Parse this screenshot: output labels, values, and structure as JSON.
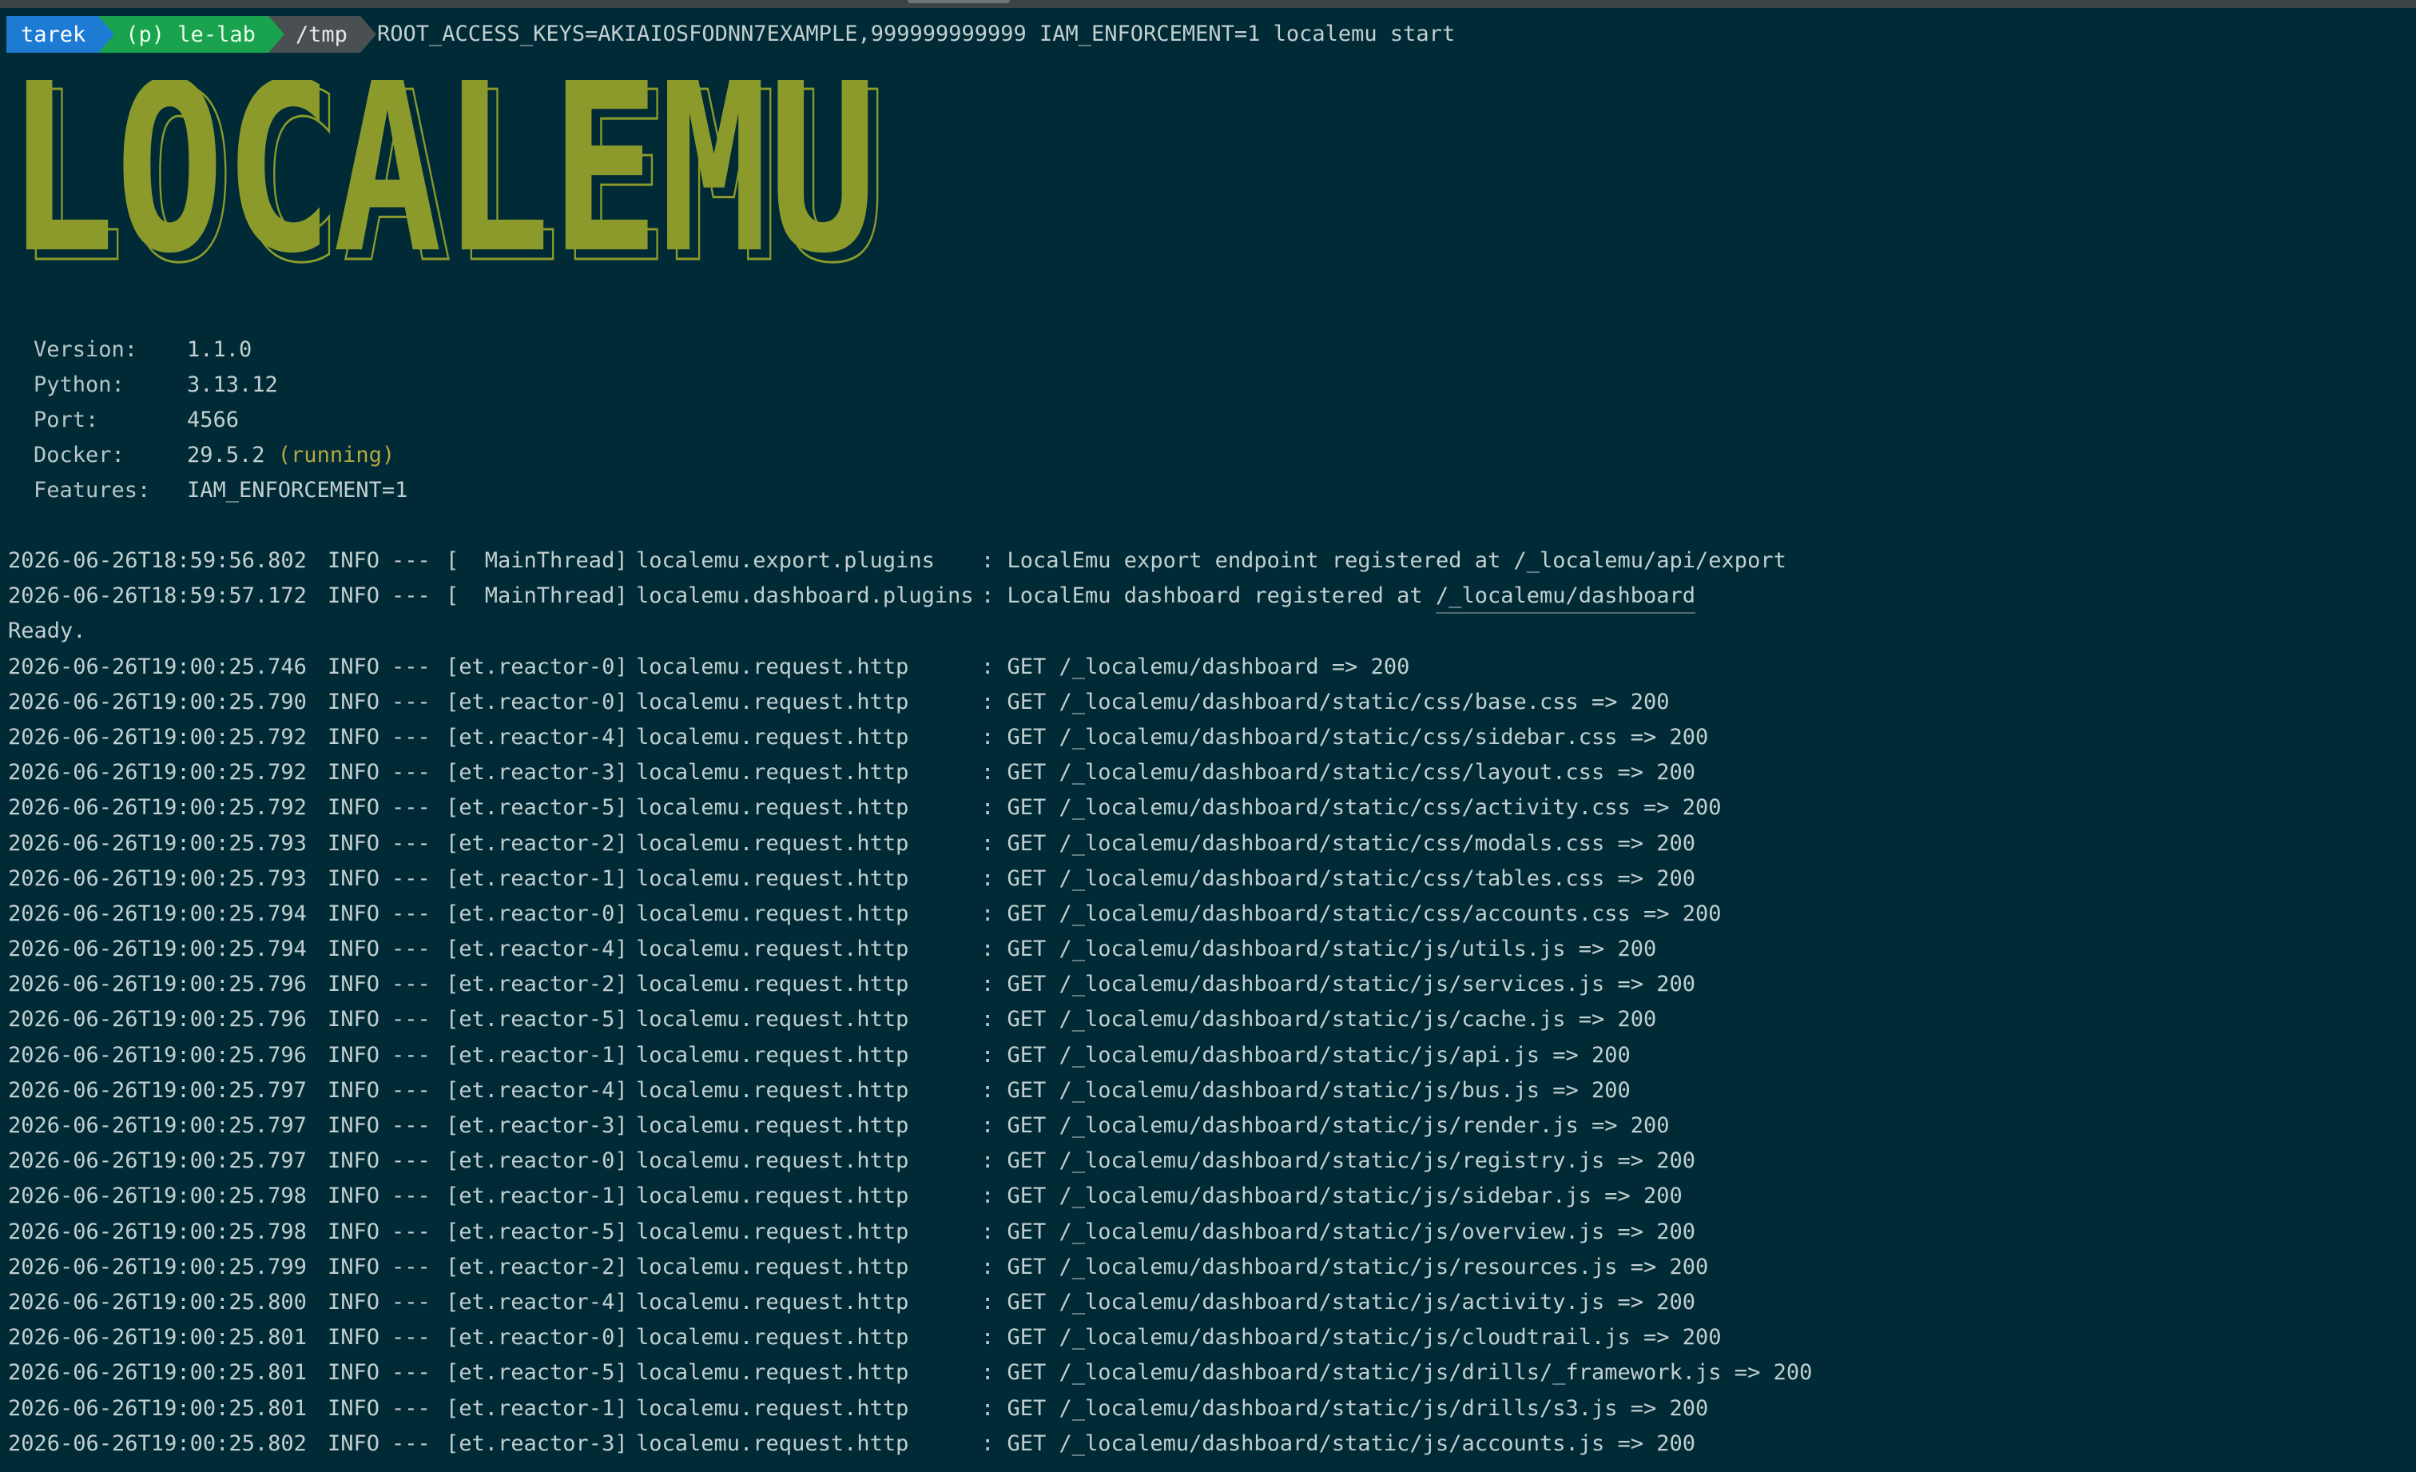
{
  "prompt": {
    "user": "tarek",
    "env": "(p) le-lab",
    "dir": "/tmp",
    "command": "ROOT_ACCESS_KEYS=AKIAIOSFODNN7EXAMPLE,999999999999 IAM_ENFORCEMENT=1 localemu start"
  },
  "logo": {
    "text": "LOCALEMU",
    "color": "#8b9a2a"
  },
  "info": [
    {
      "key": "Version:",
      "value": "1.1.0",
      "suffix": ""
    },
    {
      "key": "Python:",
      "value": "3.13.12",
      "suffix": ""
    },
    {
      "key": "Port:",
      "value": "4566",
      "suffix": ""
    },
    {
      "key": "Docker:",
      "value": "29.5.2 ",
      "suffix": "(running)"
    },
    {
      "key": "Features:",
      "value": "IAM_ENFORCEMENT=1",
      "suffix": ""
    }
  ],
  "startup_logs": [
    {
      "ts": "2026-06-26T18:59:56.802",
      "level": "INFO",
      "sep": "---",
      "thread": "[  MainThread]",
      "logger": "localemu.export.plugins",
      "msg": ": LocalEmu export endpoint registered at /_localemu/api/export",
      "link": ""
    },
    {
      "ts": "2026-06-26T18:59:57.172",
      "level": "INFO",
      "sep": "---",
      "thread": "[  MainThread]",
      "logger": "localemu.dashboard.plugins",
      "msg": ": LocalEmu dashboard registered at ",
      "link": "/_localemu/dashboard"
    }
  ],
  "ready": "Ready.",
  "request_logs": [
    {
      "ts": "2026-06-26T19:00:25.746",
      "level": "INFO",
      "sep": "---",
      "thread": "[et.reactor-0]",
      "logger": "localemu.request.http",
      "msg": ": GET /_localemu/dashboard => 200"
    },
    {
      "ts": "2026-06-26T19:00:25.790",
      "level": "INFO",
      "sep": "---",
      "thread": "[et.reactor-0]",
      "logger": "localemu.request.http",
      "msg": ": GET /_localemu/dashboard/static/css/base.css => 200"
    },
    {
      "ts": "2026-06-26T19:00:25.792",
      "level": "INFO",
      "sep": "---",
      "thread": "[et.reactor-4]",
      "logger": "localemu.request.http",
      "msg": ": GET /_localemu/dashboard/static/css/sidebar.css => 200"
    },
    {
      "ts": "2026-06-26T19:00:25.792",
      "level": "INFO",
      "sep": "---",
      "thread": "[et.reactor-3]",
      "logger": "localemu.request.http",
      "msg": ": GET /_localemu/dashboard/static/css/layout.css => 200"
    },
    {
      "ts": "2026-06-26T19:00:25.792",
      "level": "INFO",
      "sep": "---",
      "thread": "[et.reactor-5]",
      "logger": "localemu.request.http",
      "msg": ": GET /_localemu/dashboard/static/css/activity.css => 200"
    },
    {
      "ts": "2026-06-26T19:00:25.793",
      "level": "INFO",
      "sep": "---",
      "thread": "[et.reactor-2]",
      "logger": "localemu.request.http",
      "msg": ": GET /_localemu/dashboard/static/css/modals.css => 200"
    },
    {
      "ts": "2026-06-26T19:00:25.793",
      "level": "INFO",
      "sep": "---",
      "thread": "[et.reactor-1]",
      "logger": "localemu.request.http",
      "msg": ": GET /_localemu/dashboard/static/css/tables.css => 200"
    },
    {
      "ts": "2026-06-26T19:00:25.794",
      "level": "INFO",
      "sep": "---",
      "thread": "[et.reactor-0]",
      "logger": "localemu.request.http",
      "msg": ": GET /_localemu/dashboard/static/css/accounts.css => 200"
    },
    {
      "ts": "2026-06-26T19:00:25.794",
      "level": "INFO",
      "sep": "---",
      "thread": "[et.reactor-4]",
      "logger": "localemu.request.http",
      "msg": ": GET /_localemu/dashboard/static/js/utils.js => 200"
    },
    {
      "ts": "2026-06-26T19:00:25.796",
      "level": "INFO",
      "sep": "---",
      "thread": "[et.reactor-2]",
      "logger": "localemu.request.http",
      "msg": ": GET /_localemu/dashboard/static/js/services.js => 200"
    },
    {
      "ts": "2026-06-26T19:00:25.796",
      "level": "INFO",
      "sep": "---",
      "thread": "[et.reactor-5]",
      "logger": "localemu.request.http",
      "msg": ": GET /_localemu/dashboard/static/js/cache.js => 200"
    },
    {
      "ts": "2026-06-26T19:00:25.796",
      "level": "INFO",
      "sep": "---",
      "thread": "[et.reactor-1]",
      "logger": "localemu.request.http",
      "msg": ": GET /_localemu/dashboard/static/js/api.js => 200"
    },
    {
      "ts": "2026-06-26T19:00:25.797",
      "level": "INFO",
      "sep": "---",
      "thread": "[et.reactor-4]",
      "logger": "localemu.request.http",
      "msg": ": GET /_localemu/dashboard/static/js/bus.js => 200"
    },
    {
      "ts": "2026-06-26T19:00:25.797",
      "level": "INFO",
      "sep": "---",
      "thread": "[et.reactor-3]",
      "logger": "localemu.request.http",
      "msg": ": GET /_localemu/dashboard/static/js/render.js => 200"
    },
    {
      "ts": "2026-06-26T19:00:25.797",
      "level": "INFO",
      "sep": "---",
      "thread": "[et.reactor-0]",
      "logger": "localemu.request.http",
      "msg": ": GET /_localemu/dashboard/static/js/registry.js => 200"
    },
    {
      "ts": "2026-06-26T19:00:25.798",
      "level": "INFO",
      "sep": "---",
      "thread": "[et.reactor-1]",
      "logger": "localemu.request.http",
      "msg": ": GET /_localemu/dashboard/static/js/sidebar.js => 200"
    },
    {
      "ts": "2026-06-26T19:00:25.798",
      "level": "INFO",
      "sep": "---",
      "thread": "[et.reactor-5]",
      "logger": "localemu.request.http",
      "msg": ": GET /_localemu/dashboard/static/js/overview.js => 200"
    },
    {
      "ts": "2026-06-26T19:00:25.799",
      "level": "INFO",
      "sep": "---",
      "thread": "[et.reactor-2]",
      "logger": "localemu.request.http",
      "msg": ": GET /_localemu/dashboard/static/js/resources.js => 200"
    },
    {
      "ts": "2026-06-26T19:00:25.800",
      "level": "INFO",
      "sep": "---",
      "thread": "[et.reactor-4]",
      "logger": "localemu.request.http",
      "msg": ": GET /_localemu/dashboard/static/js/activity.js => 200"
    },
    {
      "ts": "2026-06-26T19:00:25.801",
      "level": "INFO",
      "sep": "---",
      "thread": "[et.reactor-0]",
      "logger": "localemu.request.http",
      "msg": ": GET /_localemu/dashboard/static/js/cloudtrail.js => 200"
    },
    {
      "ts": "2026-06-26T19:00:25.801",
      "level": "INFO",
      "sep": "---",
      "thread": "[et.reactor-5]",
      "logger": "localemu.request.http",
      "msg": ": GET /_localemu/dashboard/static/js/drills/_framework.js => 200"
    },
    {
      "ts": "2026-06-26T19:00:25.801",
      "level": "INFO",
      "sep": "---",
      "thread": "[et.reactor-1]",
      "logger": "localemu.request.http",
      "msg": ": GET /_localemu/dashboard/static/js/drills/s3.js => 200"
    },
    {
      "ts": "2026-06-26T19:00:25.802",
      "level": "INFO",
      "sep": "---",
      "thread": "[et.reactor-3]",
      "logger": "localemu.request.http",
      "msg": ": GET /_localemu/dashboard/static/js/accounts.js => 200"
    }
  ]
}
